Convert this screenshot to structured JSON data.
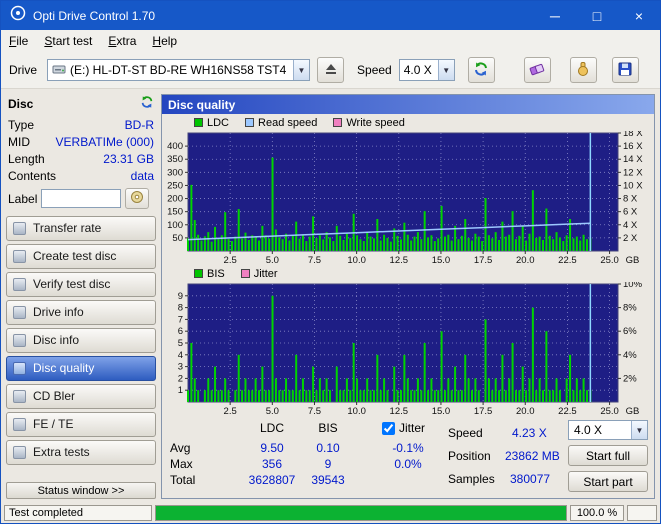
{
  "window": {
    "title": "Opti Drive Control 1.70",
    "controls": {
      "minimize": "─",
      "maximize": "□",
      "close": "×"
    }
  },
  "menu": {
    "items": [
      {
        "label": "File"
      },
      {
        "label": "Start test"
      },
      {
        "label": "Extra"
      },
      {
        "label": "Help"
      }
    ]
  },
  "toolbar": {
    "drive_label": "Drive",
    "drive_value": "(E:) HL-DT-ST BD-RE WH16NS58 TST4",
    "speed_label": "Speed",
    "speed_value": "4.0 X",
    "icons": [
      "drive",
      "eject",
      "refresh",
      "erase",
      "hand",
      "save"
    ]
  },
  "disc_panel": {
    "header": "Disc",
    "fields": [
      {
        "label": "Type",
        "value": "BD-R"
      },
      {
        "label": "MID",
        "value": "VERBATIMe (000)"
      },
      {
        "label": "Length",
        "value": "23.31 GB"
      },
      {
        "label": "Contents",
        "value": "data"
      }
    ],
    "label_field": {
      "label": "Label",
      "value": ""
    }
  },
  "nav": {
    "active": "Disc quality",
    "items": [
      {
        "label": "Transfer rate"
      },
      {
        "label": "Create test disc"
      },
      {
        "label": "Verify test disc"
      },
      {
        "label": "Drive info"
      },
      {
        "label": "Disc info"
      },
      {
        "label": "Disc quality"
      },
      {
        "label": "CD Bler"
      },
      {
        "label": "FE / TE"
      },
      {
        "label": "Extra tests"
      }
    ]
  },
  "status_window_button": "Status window >>",
  "main": {
    "header": "Disc quality",
    "legend1": [
      {
        "label": "LDC",
        "color": "#00c400"
      },
      {
        "label": "Read speed",
        "color": "#9cc8ff"
      },
      {
        "label": "Write speed",
        "color": "#f080c0"
      }
    ],
    "legend2": [
      {
        "label": "BIS",
        "color": "#00c400"
      },
      {
        "label": "Jitter",
        "color": "#f080c0"
      }
    ]
  },
  "stats": {
    "col_ldc": "LDC",
    "col_bis": "BIS",
    "rows": [
      {
        "label": "Avg",
        "ldc": "9.50",
        "bis": "0.10"
      },
      {
        "label": "Max",
        "ldc": "356",
        "bis": "9"
      },
      {
        "label": "Total",
        "ldc": "3628807",
        "bis": "39543"
      }
    ],
    "jitter": {
      "label": "Jitter",
      "checked": true,
      "values": [
        "-0.1%",
        "0.0%"
      ]
    },
    "info": [
      {
        "label": "Speed",
        "value": "4.23 X"
      },
      {
        "label": "Position",
        "value": "23862 MB"
      },
      {
        "label": "Samples",
        "value": "380077"
      }
    ],
    "speed_select": "4.0 X",
    "start_full": "Start full",
    "start_part": "Start part"
  },
  "statusbar": {
    "text": "Test completed",
    "percent": "100.0 %",
    "progress": 100
  },
  "chart_data": [
    {
      "type": "bar",
      "title": "Disc quality - LDC with read speed overlay",
      "bg": "#1e1e85",
      "grid": "#8888c8",
      "x_range": [
        0,
        25.5
      ],
      "x_ticks": [
        2.5,
        5,
        7.5,
        10,
        12.5,
        15,
        17.5,
        20,
        22.5,
        25
      ],
      "x_unit": "GB",
      "y_left": {
        "range": [
          0,
          450
        ],
        "ticks": [
          50,
          100,
          150,
          200,
          250,
          300,
          350,
          400
        ]
      },
      "y_right": {
        "range": [
          0,
          18
        ],
        "ticks": [
          2,
          4,
          6,
          8,
          10,
          12,
          14,
          16,
          18
        ],
        "suffix": " X"
      },
      "bars": {
        "name": "LDC",
        "color": "#00d400",
        "x_start": 0,
        "x_end": 23.86,
        "values": [
          48,
          252,
          118,
          62,
          40,
          56,
          72,
          36,
          92,
          50,
          60,
          148,
          46,
          38,
          55,
          160,
          48,
          70,
          42,
          60,
          56,
          40,
          96,
          60,
          48,
          356,
          82,
          52,
          45,
          66,
          40,
          58,
          112,
          47,
          62,
          38,
          55,
          132,
          49,
          60,
          44,
          72,
          52,
          38,
          96,
          58,
          42,
          66,
          50,
          142,
          60,
          45,
          38,
          74,
          55,
          48,
          122,
          40,
          62,
          50,
          36,
          86,
          58,
          44,
          108,
          62,
          40,
          55,
          72,
          45,
          152,
          52,
          60,
          38,
          48,
          172,
          55,
          62,
          40,
          96,
          45,
          58,
          122,
          50,
          40,
          66,
          55,
          38,
          202,
          60,
          48,
          72,
          42,
          112,
          55,
          62,
          152,
          45,
          58,
          96,
          40,
          66,
          232,
          50,
          55,
          42,
          162,
          58,
          45,
          72,
          52,
          38,
          60,
          122,
          48,
          55,
          40,
          62,
          45,
          50
        ]
      },
      "lines": [
        {
          "name": "Read speed",
          "color": "#9cc8ff",
          "points": [
            [
              0,
              1.74
            ],
            [
              2.5,
              2.0
            ],
            [
              5,
              2.27
            ],
            [
              7.5,
              2.53
            ],
            [
              10,
              2.79
            ],
            [
              12.5,
              3.05
            ],
            [
              15,
              3.31
            ],
            [
              17.5,
              3.57
            ],
            [
              20,
              3.84
            ],
            [
              22.5,
              4.1
            ],
            [
              23.86,
              4.23
            ]
          ]
        },
        {
          "name": "Write speed",
          "color": "#f080c0",
          "points": []
        }
      ],
      "end_marker_x": 23.86,
      "end_marker_color": "#8fd8ff"
    },
    {
      "type": "bar",
      "title": "Disc quality - BIS with jitter overlay",
      "bg": "#1e1e85",
      "grid": "#8888c8",
      "x_range": [
        0,
        25.5
      ],
      "x_ticks": [
        2.5,
        5,
        7.5,
        10,
        12.5,
        15,
        17.5,
        20,
        22.5,
        25
      ],
      "x_unit": "GB",
      "y_left": {
        "range": [
          0,
          10
        ],
        "ticks": [
          1,
          2,
          3,
          4,
          5,
          6,
          7,
          8,
          9
        ]
      },
      "y_right": {
        "range": [
          0,
          10
        ],
        "ticks": [
          2,
          4,
          6,
          8,
          10
        ],
        "suffix": "%"
      },
      "bars": {
        "name": "BIS",
        "color": "#00d400",
        "x_start": 0,
        "x_end": 23.86,
        "values": [
          1,
          5,
          2,
          1,
          0,
          1,
          2,
          1,
          3,
          1,
          1,
          2,
          1,
          0,
          1,
          4,
          1,
          2,
          1,
          1,
          2,
          1,
          3,
          1,
          1,
          9,
          2,
          1,
          1,
          2,
          1,
          1,
          4,
          1,
          2,
          1,
          1,
          3,
          1,
          2,
          1,
          2,
          1,
          0,
          3,
          1,
          1,
          2,
          1,
          5,
          2,
          1,
          1,
          2,
          1,
          1,
          4,
          1,
          2,
          1,
          0,
          3,
          1,
          1,
          4,
          2,
          1,
          1,
          2,
          1,
          5,
          1,
          2,
          1,
          1,
          6,
          1,
          2,
          1,
          3,
          1,
          1,
          4,
          2,
          1,
          2,
          1,
          0,
          7,
          2,
          1,
          2,
          1,
          4,
          1,
          2,
          5,
          1,
          1,
          3,
          1,
          2,
          8,
          1,
          2,
          1,
          6,
          1,
          1,
          2,
          1,
          0,
          2,
          4,
          1,
          2,
          1,
          2,
          1,
          1
        ]
      },
      "lines": [
        {
          "name": "Jitter",
          "color": "#f080c0",
          "points": []
        }
      ],
      "end_marker_x": 23.86,
      "end_marker_color": "#8fd8ff"
    }
  ]
}
